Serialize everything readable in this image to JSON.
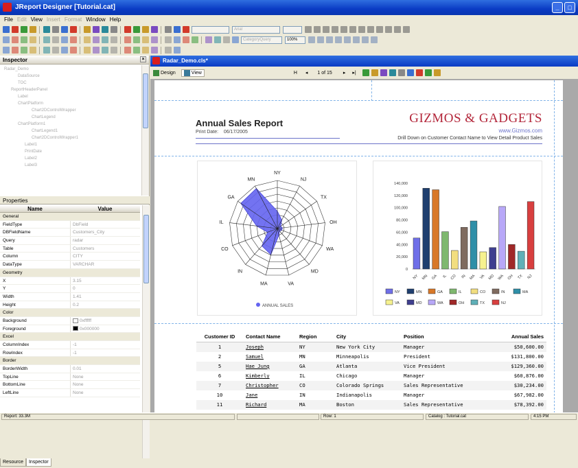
{
  "window": {
    "title": "JReport Designer [Tutorial.cat]"
  },
  "menu": [
    {
      "label": "File",
      "enabled": true
    },
    {
      "label": "Edit",
      "enabled": false
    },
    {
      "label": "View",
      "enabled": true
    },
    {
      "label": "Insert",
      "enabled": false
    },
    {
      "label": "Format",
      "enabled": false
    },
    {
      "label": "Window",
      "enabled": true
    },
    {
      "label": "Help",
      "enabled": true
    }
  ],
  "toolbar": {
    "font": "Arial",
    "zoom": "100%",
    "category": "CategoryQuery"
  },
  "inspector": {
    "title": "Inspector",
    "tree": [
      "Radar_Demo",
      "DataSource",
      "TOC",
      "ReportHeaderPanel",
      "Label",
      "ChartPlatform",
      "Chart2DControlWrapper",
      "ChartLegend",
      "ChartPlatform1",
      "ChartLegend1",
      "Chart2DControlWrapper1",
      "Label1",
      "PrintDate",
      "Label2",
      "Label3"
    ]
  },
  "properties": {
    "title": "Properties",
    "col_name": "Name",
    "col_value": "Value",
    "rows": [
      {
        "n": "General",
        "v": "",
        "cat": true
      },
      {
        "n": "FieldType",
        "v": "DbField"
      },
      {
        "n": "DBFieldName",
        "v": "Customers_City"
      },
      {
        "n": "Query",
        "v": "radar"
      },
      {
        "n": "Table",
        "v": "Customers"
      },
      {
        "n": "Column",
        "v": "CITY"
      },
      {
        "n": "DataType",
        "v": "VARCHAR"
      },
      {
        "n": "Geometry",
        "v": "",
        "cat": true
      },
      {
        "n": "X",
        "v": "3.15"
      },
      {
        "n": "Y",
        "v": "0"
      },
      {
        "n": "Width",
        "v": "1.41"
      },
      {
        "n": "Height",
        "v": "0.2"
      },
      {
        "n": "Color",
        "v": "",
        "cat": true
      },
      {
        "n": "Background",
        "v": "0xffffff"
      },
      {
        "n": "Foreground",
        "v": "0x000000"
      },
      {
        "n": "Excel",
        "v": "",
        "cat": true
      },
      {
        "n": "ColumnIndex",
        "v": "-1"
      },
      {
        "n": "RowIndex",
        "v": "-1"
      },
      {
        "n": "Border",
        "v": "",
        "cat": true
      },
      {
        "n": "BorderWidth",
        "v": "0.01"
      },
      {
        "n": "TopLine",
        "v": "None"
      },
      {
        "n": "BottomLine",
        "v": "None"
      },
      {
        "n": "LeftLine",
        "v": "None"
      }
    ]
  },
  "left_tabs": {
    "resource": "Resource",
    "inspector": "Inspector"
  },
  "doc": {
    "title": "Radar_Demo.cls*",
    "design": "Design",
    "view": "View",
    "page": "1 of 15"
  },
  "report": {
    "title": "Annual Sales Report",
    "print_date_label": "Print Date:",
    "print_date": "06/17/2005",
    "company": "GIZMOS & GADGETS",
    "url": "www.Gizmos.com",
    "drill": "Drill Down on Customer Contact Name to View Detail Product Sales",
    "radar_legend": "ANNUAL SALES",
    "columns": [
      "Customer ID",
      "Contact Name",
      "Region",
      "City",
      "Position",
      "Annual Sales"
    ],
    "rows": [
      [
        "1",
        "Joseph",
        "NY",
        "New York City",
        "Manager",
        "$50,600.00"
      ],
      [
        "2",
        "Samuel",
        "MN",
        "Minneapolis",
        "President",
        "$131,800.00"
      ],
      [
        "5",
        "Hae Jung",
        "GA",
        "Atlanta",
        "Vice President",
        "$129,360.00"
      ],
      [
        "6",
        "Kimberly",
        "IL",
        "Chicago",
        "Manager",
        "$60,876.00"
      ],
      [
        "7",
        "Christopher",
        "CO",
        "Colorado Springs",
        "Sales Representative",
        "$30,234.00"
      ],
      [
        "10",
        "Jane",
        "IN",
        "Indianapolis",
        "Manager",
        "$67,982.00"
      ],
      [
        "11",
        "Richard",
        "MA",
        "Boston",
        "Sales Representative",
        "$78,392.00"
      ]
    ]
  },
  "chart_data": [
    {
      "type": "radar",
      "categories": [
        "NY",
        "NJ",
        "TX",
        "OH",
        "WA",
        "MD",
        "VA",
        "MA",
        "IN",
        "CO",
        "IL",
        "GA",
        "MN"
      ],
      "series": [
        {
          "name": "ANNUAL SALES",
          "values": [
            50600,
            28000,
            12000,
            15000,
            14000,
            10000,
            20000,
            78392,
            67982,
            30234,
            60876,
            129360,
            131800
          ]
        }
      ],
      "color": "#6464f0"
    },
    {
      "type": "bar",
      "categories": [
        "NY",
        "MN",
        "GA",
        "IL",
        "CO",
        "IN",
        "MA",
        "VA",
        "MD",
        "WA",
        "OH",
        "TX",
        "NJ"
      ],
      "values": [
        50600,
        131800,
        129360,
        60876,
        30234,
        67982,
        78392,
        28000,
        35000,
        102000,
        40000,
        29000,
        110000
      ],
      "colors": [
        "#6f6fe8",
        "#1f3f6f",
        "#d87828",
        "#7fb86f",
        "#f2de7f",
        "#7f6b5f",
        "#2f8fa8",
        "#f6f28f",
        "#3f3f8f",
        "#b8a8f8",
        "#a02828",
        "#5fb0b8",
        "#d83f3f"
      ],
      "ylim": [
        0,
        140000
      ],
      "yticks": [
        "0",
        "20,000",
        "40,000",
        "60,000",
        "80,000",
        "100,000",
        "120,000",
        "140,000"
      ]
    }
  ],
  "status": {
    "left": "Report: 33.3M",
    "mid": "Row: 1",
    "catalog": "Catalog : Tutorial.cat",
    "time": "4:15 PM"
  }
}
